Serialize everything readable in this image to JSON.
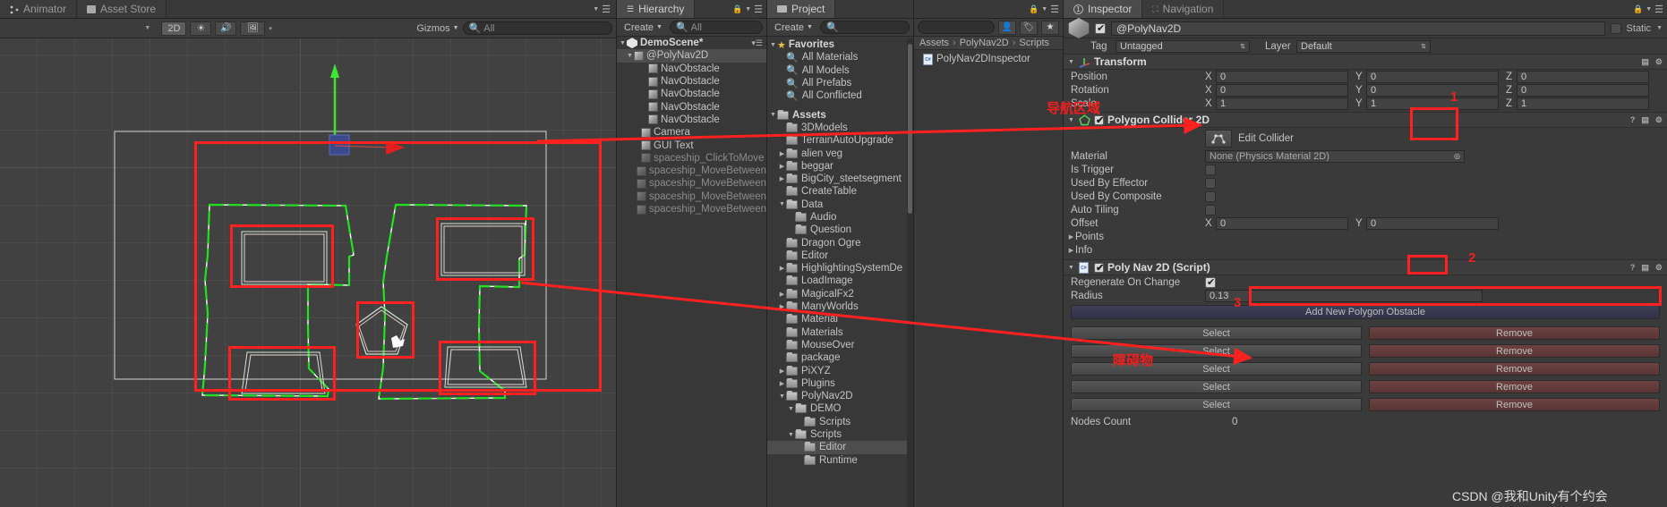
{
  "scene": {
    "tabs": [
      {
        "label": "Animator",
        "icon": "animator-icon",
        "active": false
      },
      {
        "label": "Asset Store",
        "icon": "asset-store-icon",
        "active": false
      }
    ],
    "toolbar": {
      "mode_2d": "2D",
      "lighting_icon": "sun-icon",
      "audio_icon": "speaker-icon",
      "fx_icon": "image-icon",
      "dropdown_icon": "chevron-down-icon",
      "gizmos_label": "Gizmos",
      "search_placeholder": "All",
      "search_icon": "search-icon"
    }
  },
  "hierarchy": {
    "tab_label": "Hierarchy",
    "tab_icon": "hierarchy-icon",
    "create_label": "Create",
    "search_placeholder": "All",
    "items": [
      {
        "label": "DemoScene*",
        "depth": 0,
        "icon": "unity-scene-icon",
        "expanded": true,
        "bold": true,
        "selected": false,
        "dim": false
      },
      {
        "label": "@PolyNav2D",
        "depth": 1,
        "icon": "cube-icon",
        "expanded": true,
        "bold": false,
        "selected": true,
        "dim": false
      },
      {
        "label": "NavObstacle",
        "depth": 3,
        "icon": "cube-icon",
        "expanded": false,
        "bold": false,
        "selected": false,
        "dim": false
      },
      {
        "label": "NavObstacle",
        "depth": 3,
        "icon": "cube-icon",
        "expanded": false,
        "bold": false,
        "selected": false,
        "dim": false
      },
      {
        "label": "NavObstacle",
        "depth": 3,
        "icon": "cube-icon",
        "expanded": false,
        "bold": false,
        "selected": false,
        "dim": false
      },
      {
        "label": "NavObstacle",
        "depth": 3,
        "icon": "cube-icon",
        "expanded": false,
        "bold": false,
        "selected": false,
        "dim": false
      },
      {
        "label": "NavObstacle",
        "depth": 3,
        "icon": "cube-icon",
        "expanded": false,
        "bold": false,
        "selected": false,
        "dim": false
      },
      {
        "label": "Camera",
        "depth": 2,
        "icon": "cube-icon",
        "expanded": false,
        "bold": false,
        "selected": false,
        "dim": false
      },
      {
        "label": "GUI Text",
        "depth": 2,
        "icon": "cube-icon",
        "expanded": false,
        "bold": false,
        "selected": false,
        "dim": false
      },
      {
        "label": "spaceship_ClickToMove",
        "depth": 2,
        "icon": "cube-icon",
        "expanded": false,
        "bold": false,
        "selected": false,
        "dim": true
      },
      {
        "label": "spaceship_MoveBetween",
        "depth": 2,
        "icon": "cube-icon",
        "expanded": false,
        "bold": false,
        "selected": false,
        "dim": true
      },
      {
        "label": "spaceship_MoveBetween",
        "depth": 2,
        "icon": "cube-icon",
        "expanded": false,
        "bold": false,
        "selected": false,
        "dim": true
      },
      {
        "label": "spaceship_MoveBetween",
        "depth": 2,
        "icon": "cube-icon",
        "expanded": false,
        "bold": false,
        "selected": false,
        "dim": true
      },
      {
        "label": "spaceship_MoveBetween",
        "depth": 2,
        "icon": "cube-icon",
        "expanded": false,
        "bold": false,
        "selected": false,
        "dim": true
      }
    ]
  },
  "project": {
    "tab_label": "Project",
    "tab_icon": "project-icon",
    "create_label": "Create",
    "search_placeholder": "All",
    "tree": [
      {
        "label": "Favorites",
        "depth": 0,
        "icon": "star-icon",
        "expanded": true,
        "bold": true,
        "selected": false
      },
      {
        "label": "All Materials",
        "depth": 1,
        "icon": "search-icon",
        "expanded": false,
        "bold": false,
        "selected": false
      },
      {
        "label": "All Models",
        "depth": 1,
        "icon": "search-icon",
        "expanded": false,
        "bold": false,
        "selected": false
      },
      {
        "label": "All Prefabs",
        "depth": 1,
        "icon": "search-icon",
        "expanded": false,
        "bold": false,
        "selected": false
      },
      {
        "label": "All Conflicted",
        "depth": 1,
        "icon": "search-icon",
        "expanded": false,
        "bold": false,
        "selected": false
      },
      {
        "label": "",
        "depth": 0,
        "icon": "none",
        "expanded": false,
        "bold": false,
        "selected": false
      },
      {
        "label": "Assets",
        "depth": 0,
        "icon": "folder-icon",
        "expanded": true,
        "bold": true,
        "selected": false
      },
      {
        "label": "3DModels",
        "depth": 1,
        "icon": "folder-icon",
        "expanded": false,
        "bold": false,
        "selected": false
      },
      {
        "label": "TerrainAutoUpgrade",
        "depth": 1,
        "icon": "folder-icon",
        "expanded": false,
        "bold": false,
        "selected": false
      },
      {
        "label": "alien veg",
        "depth": 1,
        "icon": "folder-icon",
        "expanded": false,
        "collapsed_arrow": true,
        "bold": false,
        "selected": false
      },
      {
        "label": "beggar",
        "depth": 1,
        "icon": "folder-icon",
        "expanded": false,
        "collapsed_arrow": true,
        "bold": false,
        "selected": false
      },
      {
        "label": "BigCity_steetsegment",
        "depth": 1,
        "icon": "folder-icon",
        "expanded": false,
        "collapsed_arrow": true,
        "bold": false,
        "selected": false
      },
      {
        "label": "CreateTable",
        "depth": 1,
        "icon": "folder-icon",
        "expanded": false,
        "bold": false,
        "selected": false
      },
      {
        "label": "Data",
        "depth": 1,
        "icon": "folder-icon",
        "expanded": true,
        "bold": false,
        "selected": false
      },
      {
        "label": "Audio",
        "depth": 2,
        "icon": "folder-icon",
        "expanded": false,
        "bold": false,
        "selected": false
      },
      {
        "label": "Question",
        "depth": 2,
        "icon": "folder-icon",
        "expanded": false,
        "bold": false,
        "selected": false
      },
      {
        "label": "Dragon Ogre",
        "depth": 1,
        "icon": "folder-icon",
        "expanded": false,
        "bold": false,
        "selected": false
      },
      {
        "label": "Editor",
        "depth": 1,
        "icon": "folder-icon",
        "expanded": false,
        "bold": false,
        "selected": false
      },
      {
        "label": "HighlightingSystemDe",
        "depth": 1,
        "icon": "folder-icon",
        "expanded": false,
        "collapsed_arrow": true,
        "bold": false,
        "selected": false
      },
      {
        "label": "LoadImage",
        "depth": 1,
        "icon": "folder-icon",
        "expanded": false,
        "bold": false,
        "selected": false
      },
      {
        "label": "MagicalFx2",
        "depth": 1,
        "icon": "folder-icon",
        "expanded": false,
        "collapsed_arrow": true,
        "bold": false,
        "selected": false
      },
      {
        "label": "ManyWorlds",
        "depth": 1,
        "icon": "folder-icon",
        "expanded": false,
        "collapsed_arrow": true,
        "bold": false,
        "selected": false
      },
      {
        "label": "Material",
        "depth": 1,
        "icon": "folder-icon",
        "expanded": false,
        "bold": false,
        "selected": false
      },
      {
        "label": "Materials",
        "depth": 1,
        "icon": "folder-icon",
        "expanded": false,
        "bold": false,
        "selected": false
      },
      {
        "label": "MouseOver",
        "depth": 1,
        "icon": "folder-icon",
        "expanded": false,
        "bold": false,
        "selected": false
      },
      {
        "label": "package",
        "depth": 1,
        "icon": "folder-icon",
        "expanded": false,
        "bold": false,
        "selected": false
      },
      {
        "label": "PiXYZ",
        "depth": 1,
        "icon": "folder-icon",
        "expanded": false,
        "collapsed_arrow": true,
        "bold": false,
        "selected": false
      },
      {
        "label": "Plugins",
        "depth": 1,
        "icon": "folder-icon",
        "expanded": false,
        "collapsed_arrow": true,
        "bold": false,
        "selected": false
      },
      {
        "label": "PolyNav2D",
        "depth": 1,
        "icon": "folder-icon",
        "expanded": true,
        "bold": false,
        "selected": false
      },
      {
        "label": "DEMO",
        "depth": 2,
        "icon": "folder-icon",
        "expanded": true,
        "bold": false,
        "selected": false
      },
      {
        "label": "Scripts",
        "depth": 3,
        "icon": "folder-icon",
        "expanded": false,
        "bold": false,
        "selected": false
      },
      {
        "label": "Scripts",
        "depth": 2,
        "icon": "folder-icon",
        "expanded": true,
        "bold": false,
        "selected": false
      },
      {
        "label": "Editor",
        "depth": 3,
        "icon": "folder-icon",
        "expanded": false,
        "bold": false,
        "selected": true
      },
      {
        "label": "Runtime",
        "depth": 3,
        "icon": "folder-icon",
        "expanded": false,
        "bold": false,
        "selected": false
      }
    ],
    "breadcrumb": [
      "Assets",
      "PolyNav2D",
      "Scripts"
    ],
    "breadcrumb_separator": "›",
    "files": [
      {
        "label": "PolyNav2DInspector",
        "icon": "csharp-file-icon"
      }
    ],
    "toolbar_icons": [
      "account-icon",
      "label-icon",
      "favorite-icon"
    ]
  },
  "inspector": {
    "tabs": [
      {
        "label": "Inspector",
        "icon": "inspector-icon",
        "active": true
      },
      {
        "label": "Navigation",
        "icon": "navigation-icon",
        "active": false
      }
    ],
    "object_name": "@PolyNav2D",
    "object_enabled": true,
    "static_label": "Static",
    "static_checked": false,
    "tag_label": "Tag",
    "tag_value": "Untagged",
    "layer_label": "Layer",
    "layer_value": "Default",
    "transform": {
      "title": "Transform",
      "icon": "transform-icon",
      "rows": [
        {
          "label": "Position",
          "x": "0",
          "y": "0",
          "z": "0"
        },
        {
          "label": "Rotation",
          "x": "0",
          "y": "0",
          "z": "0"
        },
        {
          "label": "Scale",
          "x": "1",
          "y": "1",
          "z": "1"
        }
      ]
    },
    "polygon_collider": {
      "title": "Polygon Collider 2D",
      "icon": "polygon-icon",
      "enabled": true,
      "edit_collider_label": "Edit Collider",
      "edit_collider_icon": "edit-collider-icon",
      "material_label": "Material",
      "material_value": "None (Physics Material 2D)",
      "is_trigger_label": "Is Trigger",
      "is_trigger_checked": false,
      "used_by_effector_label": "Used By Effector",
      "used_by_effector_checked": false,
      "used_by_composite_label": "Used By Composite",
      "used_by_composite_checked": false,
      "auto_tiling_label": "Auto Tiling",
      "auto_tiling_checked": false,
      "offset_label": "Offset",
      "offset_x": "0",
      "offset_y": "0",
      "points_label": "Points",
      "info_label": "Info"
    },
    "polynav": {
      "title": "Poly Nav 2D (Script)",
      "icon": "csharp-file-icon",
      "enabled": true,
      "regenerate_label": "Regenerate On Change",
      "regenerate_checked": true,
      "radius_label": "Radius",
      "radius_value": "0.13",
      "add_button_label": "Add New Polygon Obstacle",
      "obstacles": [
        {
          "select_label": "Select",
          "remove_label": "Remove"
        },
        {
          "select_label": "Select",
          "remove_label": "Remove"
        },
        {
          "select_label": "Select",
          "remove_label": "Remove"
        },
        {
          "select_label": "Select",
          "remove_label": "Remove"
        },
        {
          "select_label": "Select",
          "remove_label": "Remove"
        }
      ],
      "nodes_count_label": "Nodes Count",
      "nodes_count_value": "0"
    }
  },
  "annotations": {
    "nav_area_label": "导航区域",
    "obstacle_label": "障碍物",
    "marker_1": "1",
    "marker_2": "2",
    "marker_3": "3",
    "watermark": "CSDN @我和Unity有个约会",
    "accent_red": "#ff2020"
  }
}
